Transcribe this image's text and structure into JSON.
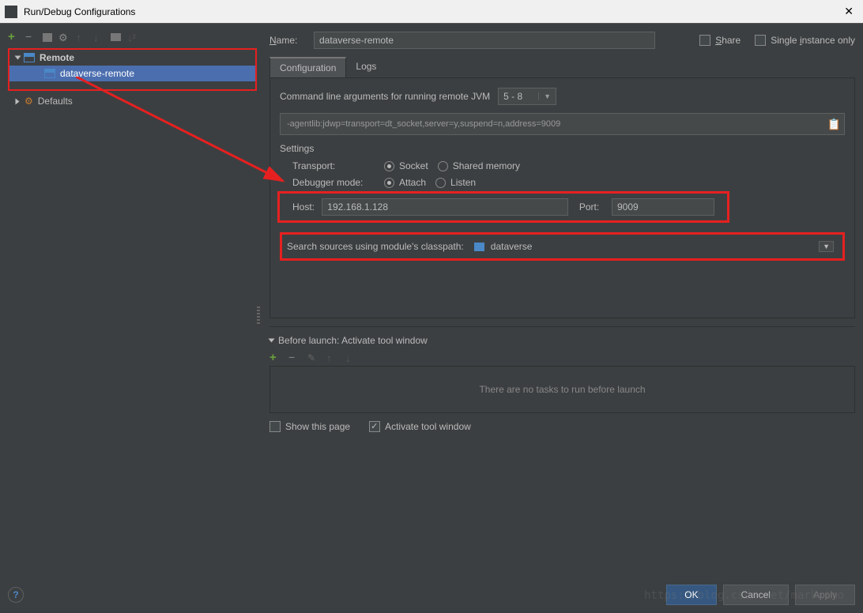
{
  "window": {
    "title": "Run/Debug Configurations"
  },
  "sidebar": {
    "remote_label": "Remote",
    "remote_child": "dataverse-remote",
    "defaults_label": "Defaults"
  },
  "name": {
    "label": "Name:",
    "value": "dataverse-remote"
  },
  "topchecks": {
    "share": "Share",
    "single": "Single instance only"
  },
  "tabs": {
    "configuration": "Configuration",
    "logs": "Logs"
  },
  "cmdline": {
    "label": "Command line arguments for running remote JVM",
    "selected": "5 - 8",
    "text": "-agentlib:jdwp=transport=dt_socket,server=y,suspend=n,address=9009"
  },
  "settings": {
    "header": "Settings",
    "transport_label": "Transport:",
    "socket": "Socket",
    "shared": "Shared memory",
    "debugger_label": "Debugger mode:",
    "attach": "Attach",
    "listen": "Listen",
    "host_label": "Host:",
    "host_value": "192.168.1.128",
    "port_label": "Port:",
    "port_value": "9009"
  },
  "classpath": {
    "label": "Search sources using module's classpath:",
    "value": "dataverse"
  },
  "before": {
    "header": "Before launch: Activate tool window",
    "empty": "There are no tasks to run before launch",
    "show_page": "Show this page",
    "activate": "Activate tool window"
  },
  "buttons": {
    "ok": "OK",
    "cancel": "Cancel",
    "apply": "Apply"
  },
  "watermark": "https://blog.csdn.net/markximo"
}
